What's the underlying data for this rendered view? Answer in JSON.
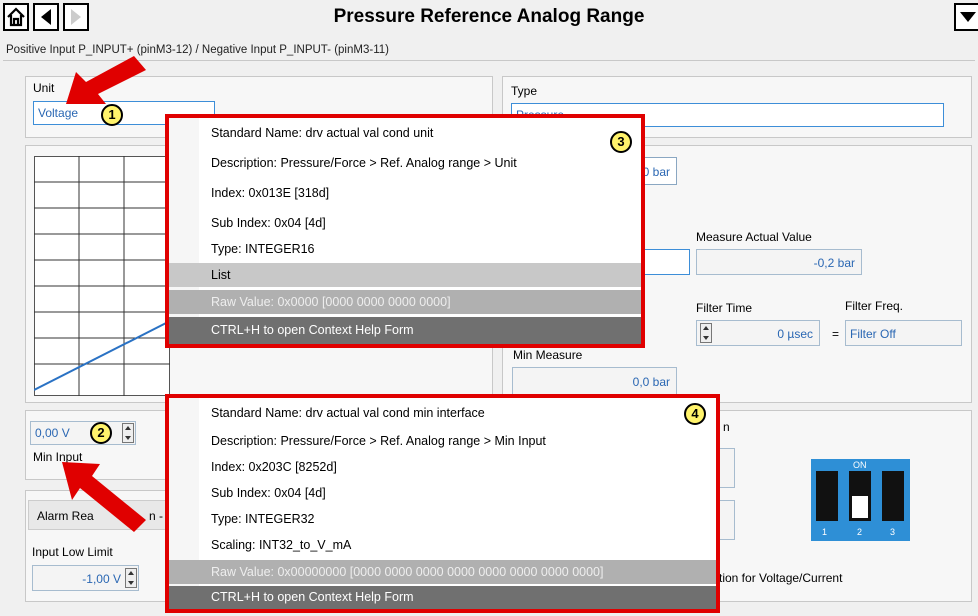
{
  "header": {
    "title": "Pressure Reference Analog Range",
    "subtitle": "Positive Input P_INPUT+ (pinM3-12) / Negative Input P_INPUT- (pinM3-11)"
  },
  "unit": {
    "label": "Unit",
    "value": "Voltage"
  },
  "type": {
    "label": "Type",
    "value": "Pressure"
  },
  "partial_values": {
    "top_bar": "0 bar"
  },
  "measure_actual": {
    "label": "Measure Actual Value",
    "value": "-0,2 bar"
  },
  "filter_time": {
    "label": "Filter Time",
    "value": "0 µsec",
    "equals": "="
  },
  "filter_freq": {
    "label": "Filter Freq.",
    "value": "Filter Off"
  },
  "min_measure": {
    "label": "Min Measure",
    "value": "0,0 bar"
  },
  "min_input": {
    "label": "Min Input",
    "value": "0,00 V"
  },
  "alarm": {
    "label_visible": "Alarm Rea",
    "label_tail": "n - O"
  },
  "input_low_limit": {
    "label": "Input  Low Limit",
    "value": "-1,00 V"
  },
  "partial_labels": {
    "option_n": "n",
    "switch_caption": "tion for Voltage/Current"
  },
  "dip_switch": {
    "on_label": "ON",
    "labels": [
      "1",
      "2",
      "3"
    ]
  },
  "badges": [
    "1",
    "2",
    "3",
    "4"
  ],
  "popup_unit": {
    "rows": [
      "Standard Name: drv actual val cond unit",
      "Description: Pressure/Force > Ref. Analog range > Unit",
      "Index: 0x013E [318d]",
      "Sub Index: 0x04 [4d]",
      "Type: INTEGER16"
    ],
    "list": "List",
    "raw": "Raw Value: 0x0000 [0000 0000 0000 0000]",
    "help": "CTRL+H to open Context Help Form"
  },
  "popup_min": {
    "rows": [
      "Standard Name: drv actual val cond min interface",
      "Description: Pressure/Force > Ref. Analog range > Min Input",
      "Index: 0x203C [8252d]",
      "Sub Index: 0x04 [4d]",
      "Type: INTEGER32",
      "Scaling: INT32_to_V_mA"
    ],
    "raw": "Raw Value: 0x00000000 [0000 0000 0000 0000 0000 0000 0000 0000]",
    "help": "CTRL+H to open Context Help Form"
  },
  "colors": {
    "highlight": "#e00000",
    "badge": "#fff36b",
    "field_text": "#2a67b3",
    "dip_switch": "#2e8fd6"
  }
}
